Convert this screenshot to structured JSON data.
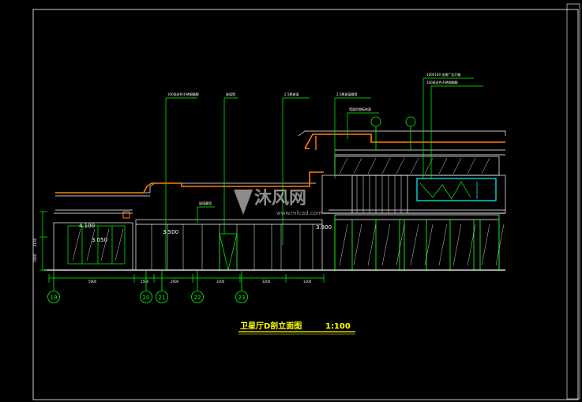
{
  "drawing": {
    "title_text": "卫星厅D剖立面图",
    "scale_text": "1:100",
    "watermark_text": "沐风网",
    "watermark_url": "www.mfcad.com"
  },
  "elevations": [
    {
      "id": "el-4100",
      "text": "4.100"
    },
    {
      "id": "el-3050",
      "text": "3.050"
    },
    {
      "id": "el-3500",
      "text": "3.500"
    },
    {
      "id": "el-3800",
      "text": "3.800"
    }
  ],
  "grid_axes": [
    {
      "id": "axis-19",
      "text": "19"
    },
    {
      "id": "axis-20",
      "text": "20"
    },
    {
      "id": "axis-21",
      "text": "21"
    },
    {
      "id": "axis-22",
      "text": "22"
    },
    {
      "id": "axis-23",
      "text": "23"
    }
  ],
  "dimensions": [
    {
      "id": "dim-1",
      "text": "5900"
    },
    {
      "id": "dim-2",
      "text": "1500"
    },
    {
      "id": "dim-3",
      "text": "2900"
    },
    {
      "id": "dim-4",
      "text": "3200"
    },
    {
      "id": "dim-5",
      "text": "3200"
    },
    {
      "id": "dim-6",
      "text": "1200"
    }
  ],
  "vertical_dims": [
    {
      "id": "vdim-1",
      "text": "4100"
    },
    {
      "id": "vdim-2",
      "text": "1000"
    }
  ],
  "annotations": [
    {
      "id": "note-1",
      "text": "100高金色不锈钢踢脚"
    },
    {
      "id": "note-2",
      "text": "玻璃墙"
    },
    {
      "id": "note-3",
      "text": "2.5厚玻璃"
    },
    {
      "id": "note-4",
      "text": "2.5厚玻璃幕墙"
    },
    {
      "id": "note-5",
      "text": "墙面铝塑板饰面"
    },
    {
      "id": "note-6",
      "text": "100X100 金属广告灯箱"
    },
    {
      "id": "note-7",
      "text": "100高金色不锈钢踢脚"
    },
    {
      "id": "note-8",
      "text": "玻璃幕墙"
    }
  ],
  "colors": {
    "background": "#000000",
    "frame": "#ffffff",
    "structure": "#ffffff",
    "green": "#00ff00",
    "orange": "#ff7f00",
    "cyan": "#00ffff",
    "title": "#ffff00",
    "leader": "#00ff00"
  }
}
